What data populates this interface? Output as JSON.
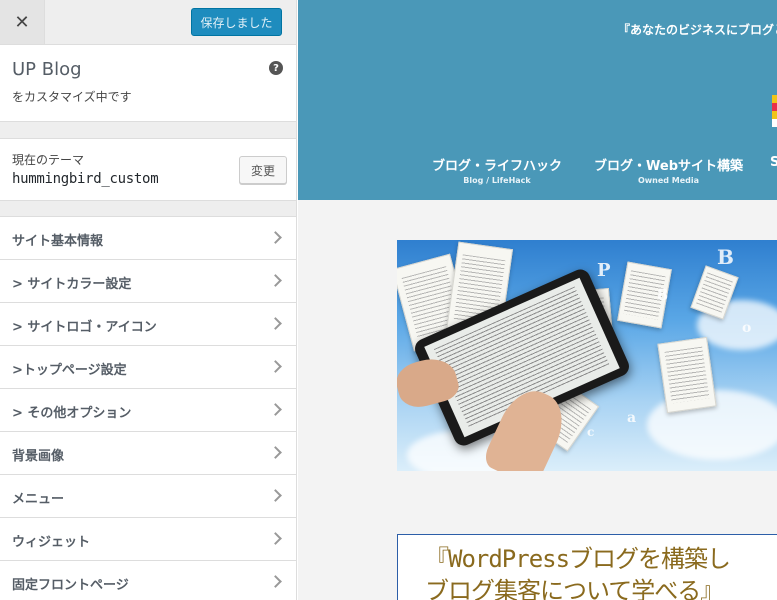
{
  "customizer": {
    "close_glyph": "✕",
    "save_label": "保存しました",
    "site_name": "UP Blog",
    "customizing_label": "をカスタマイズ中です",
    "help_glyph": "?",
    "theme_label": "現在のテーマ",
    "theme_name": "hummingbird_custom",
    "change_label": "変更",
    "sections": [
      "サイト基本情報",
      "> サイトカラー設定",
      "> サイトロゴ・アイコン",
      ">トップページ設定",
      "> その他オプション",
      "背景画像",
      "メニュー",
      "ウィジェット",
      "固定フロントページ"
    ]
  },
  "preview": {
    "tagline": "『あなたのビジネスにブログとい",
    "nav": [
      {
        "main": "ブログ・ライフハック",
        "sub": "Blog / LifeHack"
      },
      {
        "main": "ブログ・Webサイト構築",
        "sub": "Owned Media"
      },
      {
        "main": "S",
        "sub": ""
      }
    ],
    "promo_line1": "『WordPressブログを構築し",
    "promo_line2": "ブログ集客について学べる』"
  },
  "colors": {
    "header_bg": "#4a98b8",
    "save_button": "#1e8cbe",
    "promo_text": "#8a6a1e",
    "promo_border": "#2c5ea8"
  }
}
